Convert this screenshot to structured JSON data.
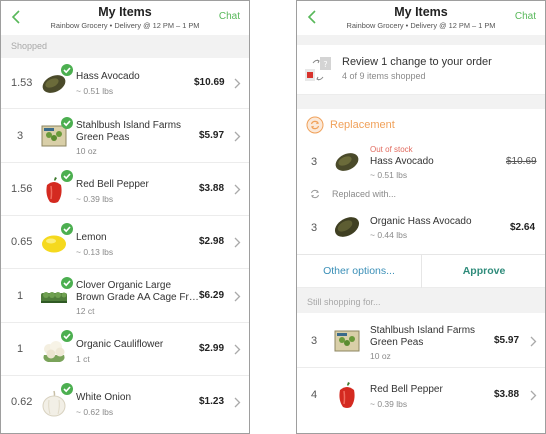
{
  "left": {
    "header": {
      "title": "My Items",
      "subtitle": "Rainbow Grocery • Delivery  @ 12 PM – 1 PM",
      "chat": "Chat"
    },
    "section": "Shopped",
    "items": [
      {
        "qty": "1.53",
        "name1": "Hass Avocado",
        "name2": "",
        "meta": "~ 0.51 lbs",
        "price": "$10.69"
      },
      {
        "qty": "3",
        "name1": "Stahlbush Island Farms",
        "name2": "Green Peas",
        "meta": "10 oz",
        "price": "$5.97"
      },
      {
        "qty": "1.56",
        "name1": "Red Bell Pepper",
        "name2": "",
        "meta": "~ 0.39 lbs",
        "price": "$3.88"
      },
      {
        "qty": "0.65",
        "name1": "Lemon",
        "name2": "",
        "meta": "~ 0.13 lbs",
        "price": "$2.98"
      },
      {
        "qty": "1",
        "name1": "Clover Organic Large",
        "name2": "Brown Grade AA Cage Fr…",
        "meta": "12 ct",
        "price": "$6.29"
      },
      {
        "qty": "1",
        "name1": "Organic Cauliflower",
        "name2": "",
        "meta": "1 ct",
        "price": "$2.99"
      },
      {
        "qty": "0.62",
        "name1": "White Onion",
        "name2": "",
        "meta": "~ 0.62 lbs",
        "price": "$1.23"
      }
    ]
  },
  "right": {
    "header": {
      "title": "My Items",
      "subtitle": "Rainbow Grocery • Delivery  @ 12 PM – 1 PM",
      "chat": "Chat"
    },
    "review": {
      "title": "Review 1 change to your order",
      "subtitle": "4 of 9 items shopped"
    },
    "replacement": {
      "label": "Replacement",
      "original": {
        "status": "Out of stock",
        "qty": "3",
        "name": "Hass Avocado",
        "meta": "~ 0.51 lbs",
        "price": "$10.69"
      },
      "replaced_with_label": "Replaced with...",
      "replacement_item": {
        "qty": "3",
        "name": "Organic Hass Avocado",
        "meta": "~ 0.44 lbs",
        "price": "$2.64"
      },
      "other_options": "Other options...",
      "approve": "Approve"
    },
    "still_section": "Still shopping for...",
    "still_items": [
      {
        "qty": "3",
        "name1": "Stahlbush Island Farms",
        "name2": "Green Peas",
        "meta": "10 oz",
        "price": "$5.97"
      },
      {
        "qty": "4",
        "name1": "Red Bell Pepper",
        "name2": "",
        "meta": "~ 0.39 lbs",
        "price": "$3.88"
      }
    ]
  },
  "colors": {
    "accent_green": "#58b85a",
    "check_green": "#4caf50",
    "replacement_orange": "#f0a15a",
    "out_of_stock_red": "#e26b5f",
    "link_blue": "#3a8fb7",
    "approve_teal": "#2e8b7a"
  },
  "icons": [
    "back-chevron-icon",
    "check-icon",
    "chevron-right-icon",
    "refresh-icon",
    "swap-icon",
    "avocado-icon",
    "peas-icon",
    "pepper-icon",
    "lemon-icon",
    "eggs-icon",
    "cauliflower-icon",
    "onion-icon"
  ]
}
